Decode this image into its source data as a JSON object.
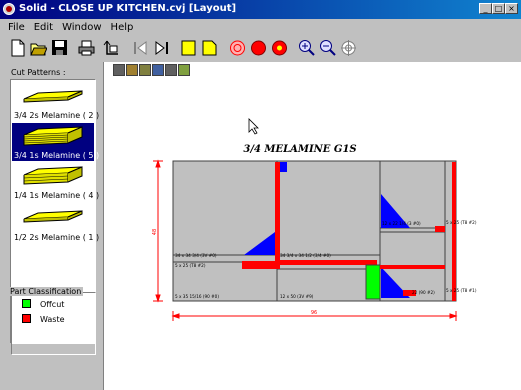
{
  "window": {
    "title": "Solid - CLOSE UP KITCHEN.cvj [Layout]",
    "minimize": "_",
    "maximize": "□",
    "close": "×"
  },
  "menu": {
    "file": "File",
    "edit": "Edit",
    "window": "Window",
    "help": "Help"
  },
  "toolbar": {
    "buttons": [
      "new-icon",
      "open-icon",
      "save-icon",
      "print-icon",
      "export-icon",
      "first-icon",
      "last-icon",
      "square-icon",
      "sheet-icon",
      "target-icon",
      "stop-icon",
      "stop-all-icon",
      "zoom-in-icon",
      "zoom-out-icon",
      "zoom-fit-icon"
    ],
    "colors": {
      "yellow": "#ffff00",
      "red": "#ff0000",
      "blue": "#0000cc"
    }
  },
  "left_panel": {
    "heading": "Cut Patterns :",
    "patterns": [
      {
        "label": "3/4 2s Melamine ( 2 )",
        "selected": false,
        "layers": 2
      },
      {
        "label": "3/4 1s Melamine ( 5 )",
        "selected": true,
        "layers": 5
      },
      {
        "label": "1/4 1s Melamine ( 4 )",
        "selected": false,
        "layers": 4
      },
      {
        "label": "1/2 2s Melamine ( 1 )",
        "selected": false,
        "layers": 1
      }
    ],
    "classification": {
      "title": "Part Classification",
      "items": [
        {
          "label": "Offcut",
          "color": "#00ff00"
        },
        {
          "label": "Waste",
          "color": "#ff0000"
        }
      ]
    }
  },
  "layout": {
    "sheet_title": "3/4 MELAMINE G1S",
    "dim_width": "96",
    "dim_height": "48",
    "part_labels": [
      "34 x 34 3/4 (3V #0)",
      "5 x 25 (T8 #2)",
      "5 x 35 15/16 (90 #0)",
      "34 3/4 x 34 1/2 (3/4 #0)",
      "12 x 50 (3V #9)",
      "12 x 22 1/4 (3 #0)",
      "5 x 25 (T8 #2)",
      "22 (90 #2)",
      "5 x 25 (T8 #1)"
    ],
    "colors": {
      "sheet": "#c0c0c0",
      "part_border": "#404040",
      "blue": "#0000ff",
      "red": "#ff0000",
      "green": "#00ff00",
      "dim_line": "#ff0000"
    }
  }
}
